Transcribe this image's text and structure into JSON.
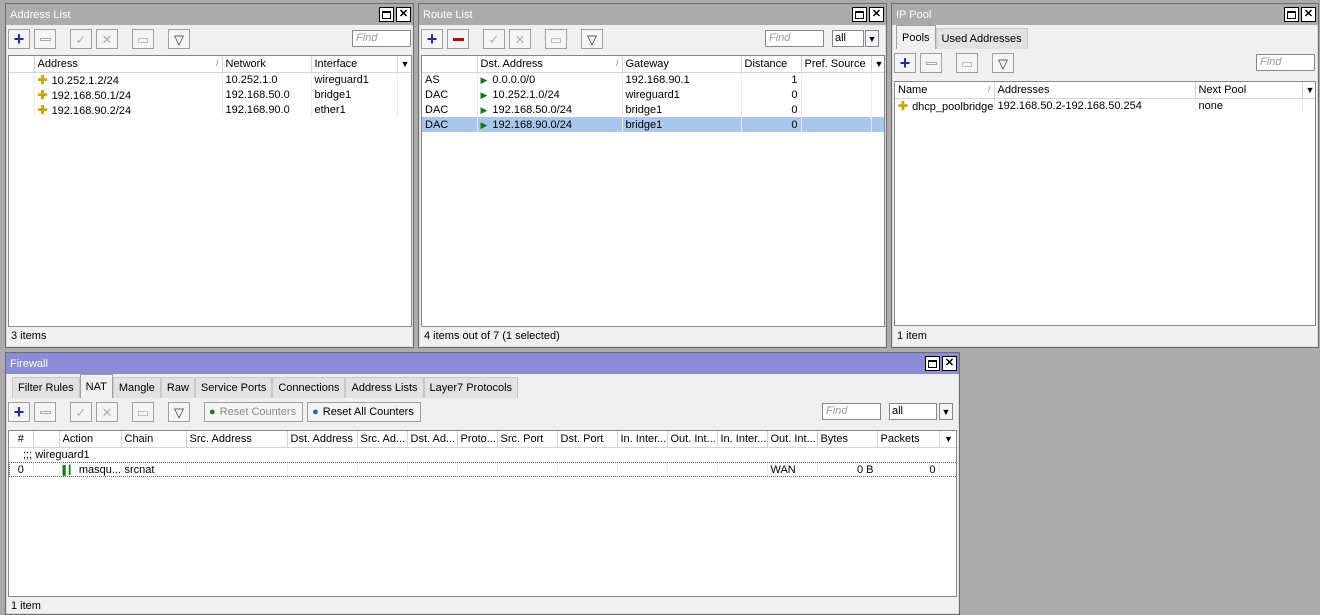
{
  "address_list": {
    "title": "Address List",
    "find_placeholder": "Find",
    "columns": [
      "Address",
      "Network",
      "Interface"
    ],
    "rows": [
      {
        "address": "10.252.1.2/24",
        "network": "10.252.1.0",
        "interface": "wireguard1"
      },
      {
        "address": "192.168.50.1/24",
        "network": "192.168.50.0",
        "interface": "bridge1"
      },
      {
        "address": "192.168.90.2/24",
        "network": "192.168.90.0",
        "interface": "ether1"
      }
    ],
    "status": "3 items"
  },
  "route_list": {
    "title": "Route List",
    "find_placeholder": "Find",
    "filter_value": "all",
    "columns": [
      "Dst. Address",
      "Gateway",
      "Distance",
      "Pref. Source"
    ],
    "rows": [
      {
        "flags": "AS",
        "dst": "0.0.0.0/0",
        "gateway": "192.168.90.1",
        "distance": "1",
        "pref": ""
      },
      {
        "flags": "DAC",
        "dst": "10.252.1.0/24",
        "gateway": "wireguard1",
        "distance": "0",
        "pref": ""
      },
      {
        "flags": "DAC",
        "dst": "192.168.50.0/24",
        "gateway": "bridge1",
        "distance": "0",
        "pref": ""
      },
      {
        "flags": "DAC",
        "dst": "192.168.90.0/24",
        "gateway": "bridge1",
        "distance": "0",
        "pref": ""
      }
    ],
    "selected_row": 3,
    "status": "4 items out of 7 (1 selected)"
  },
  "ip_pool": {
    "title": "IP Pool",
    "tabs": [
      "Pools",
      "Used Addresses"
    ],
    "find_placeholder": "Find",
    "columns": [
      "Name",
      "Addresses",
      "Next Pool"
    ],
    "rows": [
      {
        "name": "dhcp_poolbridge",
        "addresses": "192.168.50.2-192.168.50.254",
        "next": "none"
      }
    ],
    "status": "1 item"
  },
  "firewall": {
    "title": "Firewall",
    "tabs": [
      "Filter Rules",
      "NAT",
      "Mangle",
      "Raw",
      "Service Ports",
      "Connections",
      "Address Lists",
      "Layer7 Protocols"
    ],
    "reset_counters": "Reset Counters",
    "reset_all_counters": "Reset All Counters",
    "find_placeholder": "Find",
    "filter_value": "all",
    "columns": [
      "#",
      "",
      "Action",
      "Chain",
      "Src. Address",
      "Dst. Address",
      "Src. Ad...",
      "Dst. Ad...",
      "Proto...",
      "Src. Port",
      "Dst. Port",
      "In. Inter...",
      "Out. Int...",
      "In. Inter...",
      "Out. Int...",
      "Bytes",
      "Packets"
    ],
    "comment": ";;; wireguard1",
    "rows": [
      {
        "num": "0",
        "action": "masqu...",
        "chain": "srcnat",
        "out_int": "WAN",
        "bytes": "0 B",
        "packets": "0"
      }
    ],
    "status": "1 item"
  },
  "icons": {
    "add": "plus-icon",
    "remove": "minus-icon",
    "enable": "check-icon",
    "disable": "x-icon",
    "comment": "note-icon",
    "filter": "funnel-icon",
    "restore": "restore-icon",
    "close": "close-icon"
  },
  "colors": {
    "active_title": "#8b8bd8",
    "inactive_title": "#ababab",
    "selected_row": "#a9c6ec",
    "desktop": "#ababab"
  }
}
